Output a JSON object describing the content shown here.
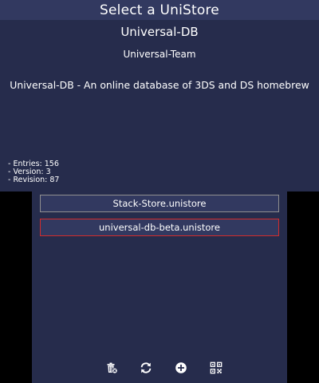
{
  "top": {
    "title": "Select a UniStore",
    "store": {
      "name": "Universal-DB",
      "author": "Universal-Team",
      "description": "Universal-DB - An online database of 3DS and DS homebrew",
      "entries": "- Entries: 156",
      "version": "- Version: 3",
      "revision": "- Revision: 87"
    }
  },
  "bottom": {
    "stores": [
      {
        "label": "Stack-Store.unistore"
      },
      {
        "label": "universal-db-beta.unistore"
      }
    ],
    "toolbar": {
      "icons": [
        "delete-icon",
        "refresh-icon",
        "add-icon",
        "qr-code-icon"
      ]
    }
  },
  "colors": {
    "background": "#262c4c",
    "bar": "#323960",
    "selected_border": "#d32b2b",
    "button_border": "#8f8f8f"
  }
}
